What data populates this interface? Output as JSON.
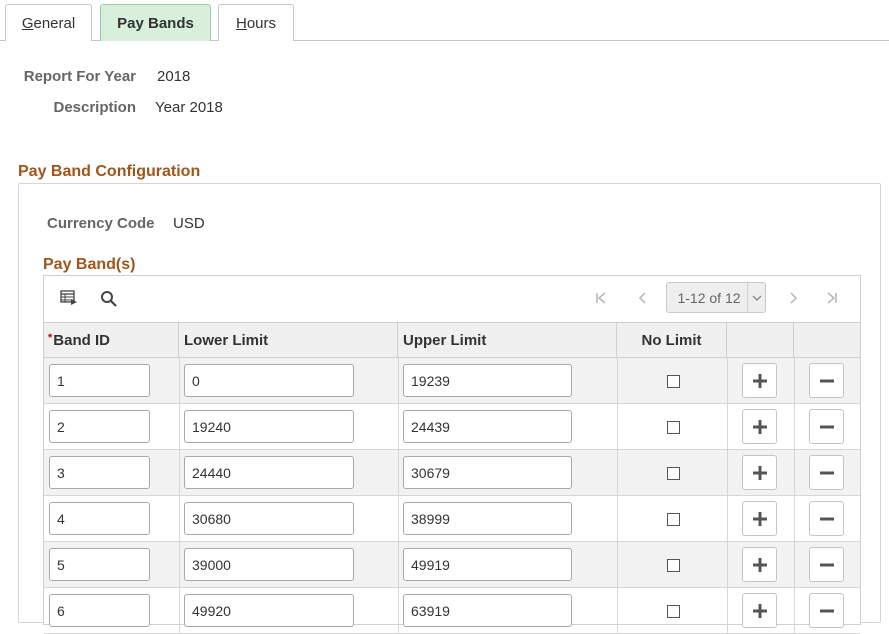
{
  "tabs": [
    {
      "label": "General",
      "key_letter": "G",
      "rest": "eneral",
      "active": false
    },
    {
      "label": "Pay Bands",
      "active": true
    },
    {
      "label": "Hours",
      "key_letter": "H",
      "rest": "ours",
      "active": false
    }
  ],
  "header": {
    "report_for_year_label": "Report For Year",
    "report_for_year_value": "2018",
    "description_label": "Description",
    "description_value": "Year 2018"
  },
  "config": {
    "title": "Pay Band Configuration",
    "currency_label": "Currency Code",
    "currency_value": "USD",
    "grid_title": "Pay Band(s)"
  },
  "grid": {
    "pager_text": "1-12 of 12",
    "required_marker": "*",
    "columns": {
      "band_id": "Band ID",
      "lower_limit": "Lower Limit",
      "upper_limit": "Upper Limit",
      "no_limit": "No Limit"
    },
    "rows": [
      {
        "band_id": "1",
        "lower": "0",
        "upper": "19239",
        "no_limit": false
      },
      {
        "band_id": "2",
        "lower": "19240",
        "upper": "24439",
        "no_limit": false
      },
      {
        "band_id": "3",
        "lower": "24440",
        "upper": "30679",
        "no_limit": false
      },
      {
        "band_id": "4",
        "lower": "30680",
        "upper": "38999",
        "no_limit": false
      },
      {
        "band_id": "5",
        "lower": "39000",
        "upper": "49919",
        "no_limit": false
      },
      {
        "band_id": "6",
        "lower": "49920",
        "upper": "63919",
        "no_limit": false
      }
    ]
  },
  "icons": {
    "grid_view": "personalize-grid-icon",
    "find": "search-icon",
    "first": "first-page-icon",
    "prev": "previous-page-icon",
    "next": "next-page-icon",
    "last": "last-page-icon",
    "add": "plus-icon",
    "delete": "minus-icon"
  },
  "colors": {
    "section_title": "#a0551b",
    "active_tab_bg": "#d8efdb",
    "header_bg": "#f0f0f0",
    "alt_row_bg": "#f2f2f2"
  }
}
